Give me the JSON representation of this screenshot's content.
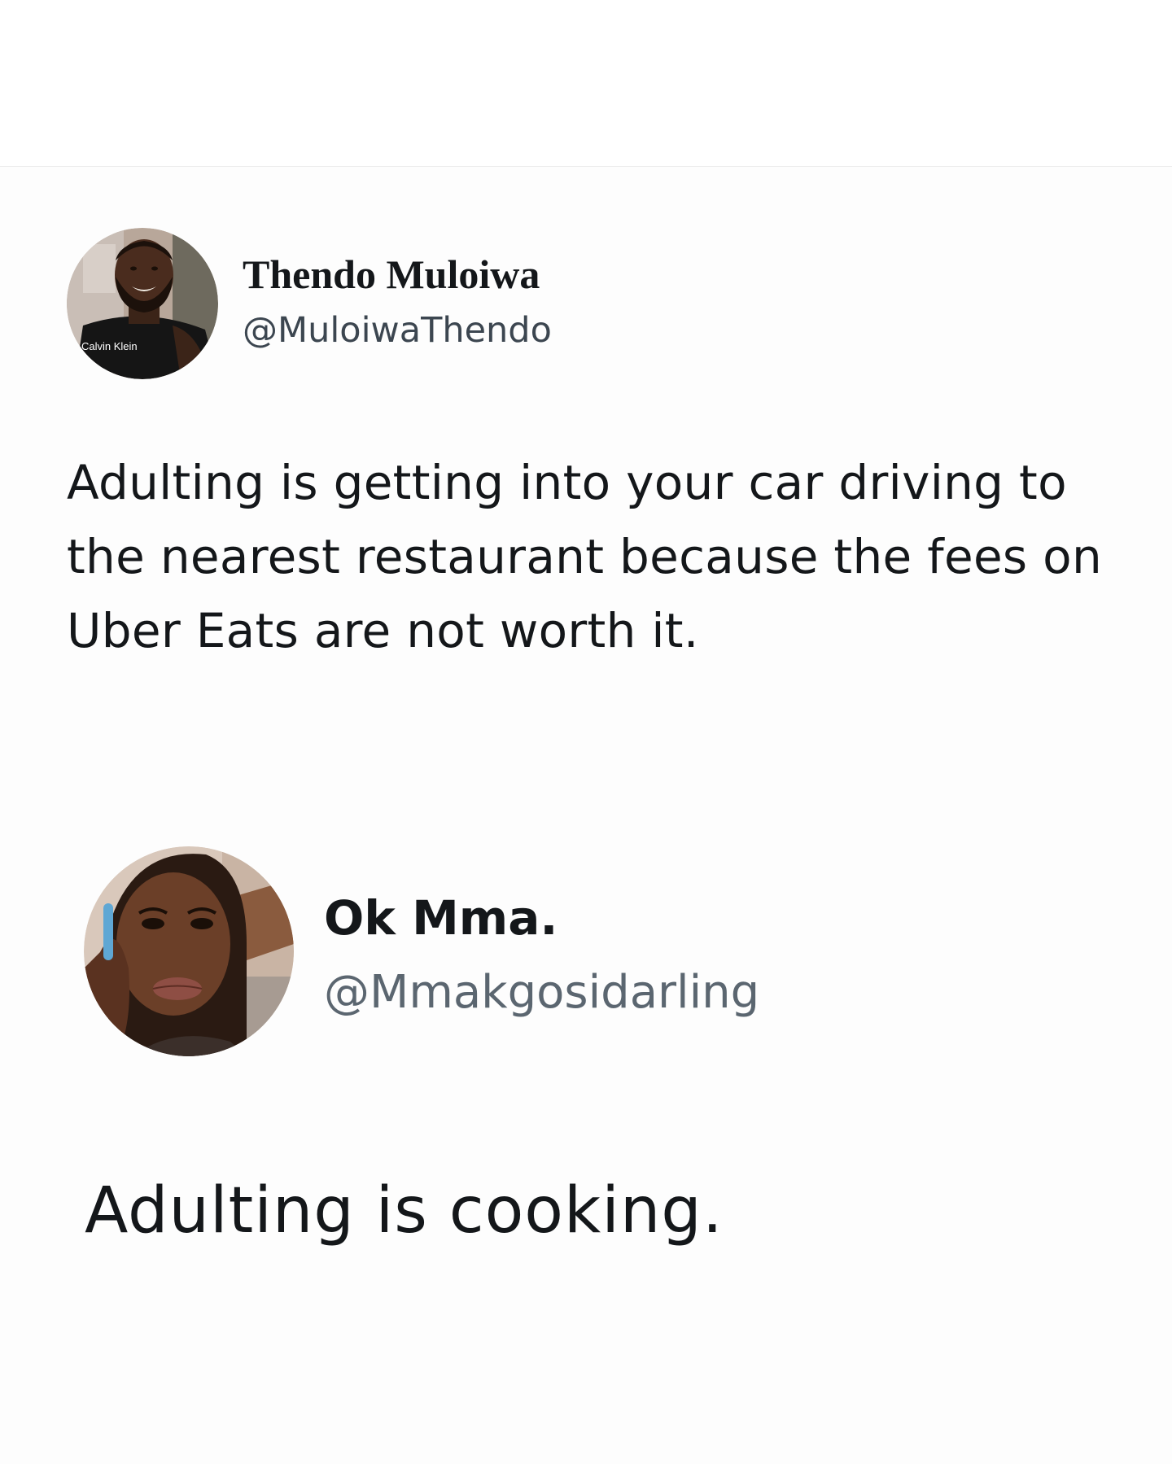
{
  "tweets": [
    {
      "display_name": "Thendo Muloiwa",
      "handle": "@MuloiwaThendo",
      "text": "Adulting is getting into your car driving to the nearest restaurant because the fees on Uber Eats are not worth it.",
      "avatar": {
        "icon": "profile-photo-man-icon",
        "shirt_print": "Calvin Klein"
      }
    },
    {
      "display_name": "Ok Mma.",
      "handle": "@Mmakgosidarling",
      "text": "Adulting is cooking.",
      "avatar": {
        "icon": "profile-photo-woman-icon"
      }
    }
  ],
  "colors": {
    "text_primary": "#14171a",
    "text_secondary": "#5b6670",
    "background": "#fdfdfd",
    "divider": "#ececec"
  }
}
